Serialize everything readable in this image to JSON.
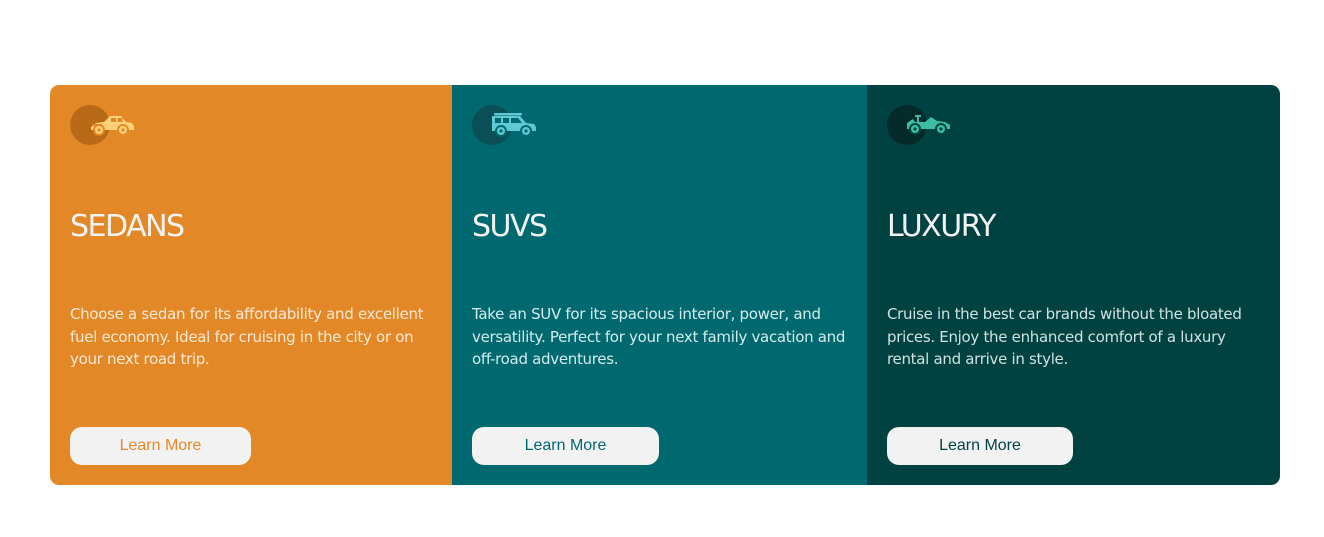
{
  "cards": [
    {
      "icon": "sedan-car-icon",
      "icon_color": "#ffd07a",
      "title": "SEDANS",
      "description": "Choose a sedan for its affordability and excellent fuel economy. Ideal for cruising in the city or on your next road trip.",
      "button_label": "Learn More",
      "background": "#e38826"
    },
    {
      "icon": "suv-car-icon",
      "icon_color": "#5fc9d3",
      "title": "SUVS",
      "description": "Take an SUV for its spacious interior, power, and versatility. Perfect for your next family vacation and off-road adventures.",
      "button_label": "Learn More",
      "background": "#006970"
    },
    {
      "icon": "convertible-car-icon",
      "icon_color": "#3cbfa0",
      "title": "LUXURY",
      "description": "Cruise in the best car brands without the bloated prices. Enjoy the enhanced comfort of a luxury rental and arrive in style.",
      "button_label": "Learn More",
      "background": "#004241"
    }
  ]
}
